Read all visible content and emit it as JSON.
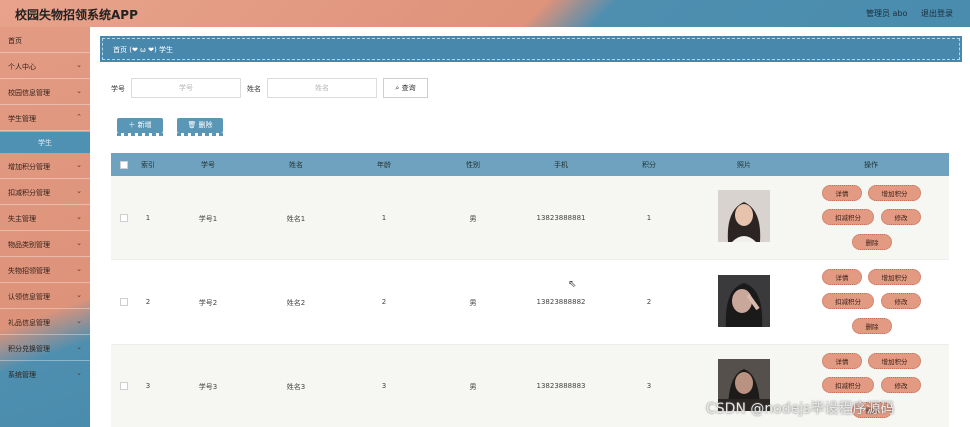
{
  "header": {
    "app_title": "校园失物招领系统APP",
    "user_label": "管理员 abo",
    "logout_label": "退出登录"
  },
  "sidebar": {
    "items": [
      {
        "label": "首页",
        "chevron": ""
      },
      {
        "label": "个人中心",
        "chevron": "⌄"
      },
      {
        "label": "校园信息管理",
        "chevron": "⌄"
      },
      {
        "label": "学生管理",
        "chevron": "⌃"
      },
      {
        "label": "增加积分管理",
        "chevron": "⌄"
      },
      {
        "label": "扣减积分管理",
        "chevron": "⌄"
      },
      {
        "label": "失主管理",
        "chevron": "⌄"
      },
      {
        "label": "物品类别管理",
        "chevron": "⌄"
      },
      {
        "label": "失物招领管理",
        "chevron": "⌄"
      },
      {
        "label": "认领信息管理",
        "chevron": "⌄"
      },
      {
        "label": "礼品信息管理",
        "chevron": "⌄"
      },
      {
        "label": "积分兑换管理",
        "chevron": "⌄"
      },
      {
        "label": "系统管理",
        "chevron": "⌄"
      }
    ],
    "active_sub": "学生"
  },
  "breadcrumb": {
    "home": "首页",
    "separator": "(❤ ω ❤)",
    "current": "学生"
  },
  "search": {
    "student_no_label": "学号",
    "student_no_placeholder": "学号",
    "name_label": "姓名",
    "name_placeholder": "姓名",
    "search_button": "查询"
  },
  "actions": {
    "add_label": "＋ 新增",
    "delete_label": "🗑 删除"
  },
  "table": {
    "columns": [
      "索引",
      "学号",
      "姓名",
      "年龄",
      "性别",
      "手机",
      "积分",
      "照片",
      "操作"
    ],
    "rows": [
      {
        "index": "1",
        "student_no": "学号1",
        "name": "姓名1",
        "age": "1",
        "gender": "男",
        "phone": "13823888881",
        "points": "1"
      },
      {
        "index": "2",
        "student_no": "学号2",
        "name": "姓名2",
        "age": "2",
        "gender": "男",
        "phone": "13823888882",
        "points": "2"
      },
      {
        "index": "3",
        "student_no": "学号3",
        "name": "姓名3",
        "age": "3",
        "gender": "男",
        "phone": "13823888883",
        "points": "3"
      }
    ],
    "row_actions": {
      "detail": "详情",
      "add_points": "增加积分",
      "deduct_points": "扣减积分",
      "edit": "修改",
      "delete": "删除"
    }
  },
  "watermark": "CSDN @nodejs毕设程序源码",
  "colors": {
    "accent_salmon": "#e39a83",
    "accent_blue": "#4a8cad",
    "table_header": "#6ea2bf"
  }
}
